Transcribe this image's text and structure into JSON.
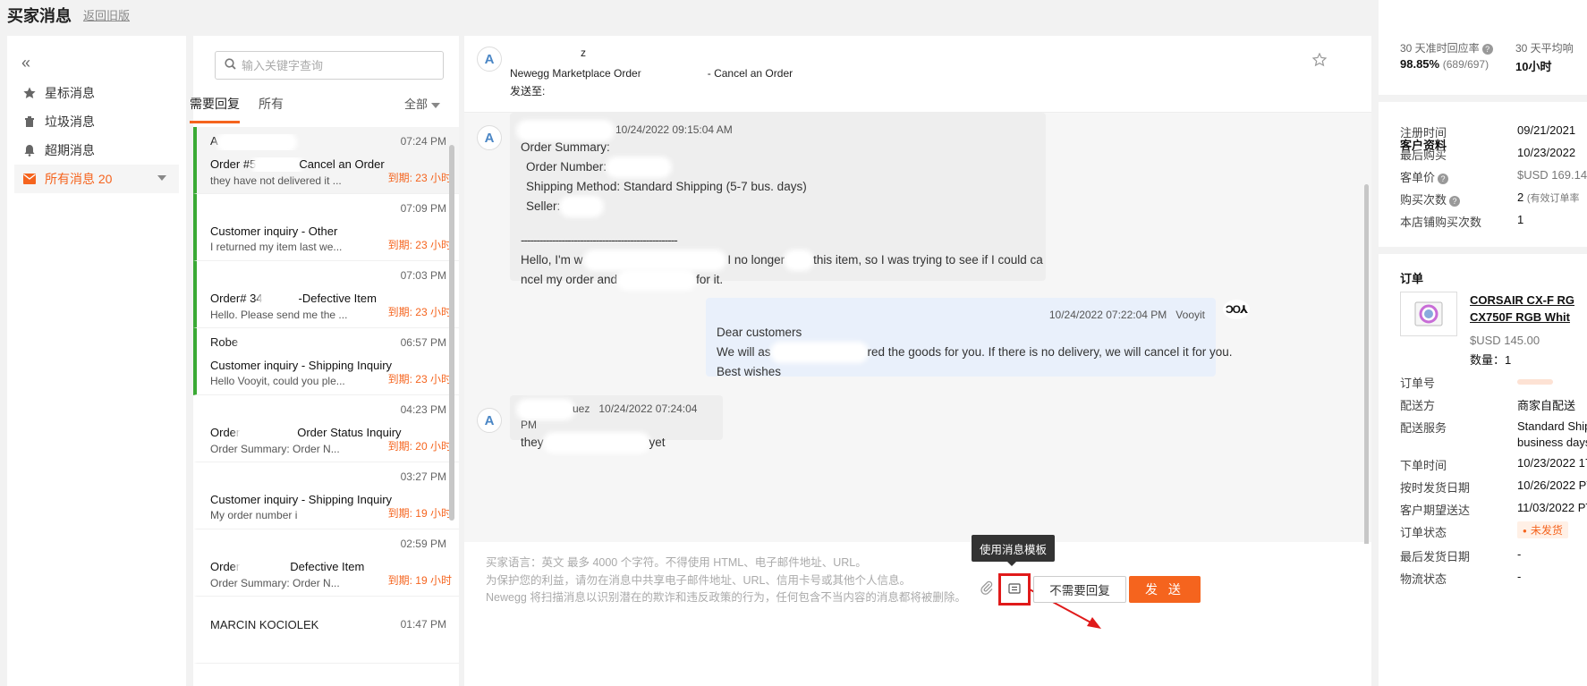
{
  "header": {
    "title": "买家消息",
    "back_link": "返回旧版"
  },
  "nav": {
    "collapse": "«",
    "items": [
      {
        "icon": "star-icon",
        "label": "星标消息"
      },
      {
        "icon": "trash-icon",
        "label": "垃圾消息"
      },
      {
        "icon": "bell-icon",
        "label": "超期消息"
      },
      {
        "icon": "mail-icon",
        "label": "所有消息 20"
      }
    ]
  },
  "list": {
    "search_placeholder": "输入关键字查询",
    "tabs": [
      "需要回复",
      "所有"
    ],
    "filter": "全部",
    "messages": [
      {
        "sender": "A",
        "time": "07:24 PM",
        "subject": "Order #5",
        "subject_suffix": "Cancel an Order",
        "preview": "they have not delivered it ...",
        "due": "到期: 23 小时"
      },
      {
        "sender": "",
        "time": "07:09 PM",
        "subject": "Customer inquiry - Other",
        "subject_suffix": "",
        "preview": "I returned my item last we...",
        "due": "到期: 23 小时"
      },
      {
        "sender": "",
        "time": "07:03 PM",
        "subject": "Order# 34",
        "subject_suffix": "-Defective Item",
        "preview": "Hello. Please send me the ...",
        "due": "到期: 23 小时"
      },
      {
        "sender": "Robe",
        "time": "06:57 PM",
        "subject": "Customer inquiry - Shipping Inquiry",
        "subject_suffix": "",
        "preview": "Hello Vooyit, could you ple...",
        "due": "到期: 23 小时"
      },
      {
        "sender": "",
        "time": "04:23 PM",
        "subject": "Order",
        "subject_suffix": "Order Status Inquiry",
        "preview": "Order Summary:   Order N...",
        "due": "到期: 20 小时"
      },
      {
        "sender": "",
        "time": "03:27 PM",
        "subject": "Customer inquiry - Shipping Inquiry",
        "subject_suffix": "",
        "preview": "My order number i",
        "due": "到期: 19 小时"
      },
      {
        "sender": "",
        "time": "02:59 PM",
        "subject": "Order",
        "subject_suffix": "Defective Item",
        "preview": "Order Summary:   Order N...",
        "due": "到期: 19 小时"
      },
      {
        "sender": "MARCIN KOCIOLEK",
        "time": "01:47 PM",
        "subject": "",
        "subject_suffix": "",
        "preview": "",
        "due": ""
      }
    ]
  },
  "conversation": {
    "header": {
      "avatar": "A",
      "name": "z",
      "subject": "Newegg Marketplace Order",
      "subject_suffix": "- Cancel an Order",
      "to": "发送至:"
    },
    "messages": [
      {
        "dir": "in",
        "avatar": "A",
        "timestamp": "10/24/2022 09:15:04 AM",
        "lines": [
          "Order Summary:",
          "  Order Number:",
          "  Shipping Method: Standard Shipping (5-7 bus. days)",
          "  Seller:",
          "",
          "--------------------------------------------------",
          "Hello, I'm w",
          "I no longer",
          "this item, so I was trying to see if I could ca",
          "ncel my order and",
          "for it."
        ]
      },
      {
        "dir": "out",
        "sender": "Vooyit",
        "timestamp": "10/24/2022 07:22:04 PM",
        "lines": [
          "Dear customers",
          "We will as",
          "red the goods for you. If there is no delivery, we will cancel it for you.",
          "Best wishes"
        ]
      },
      {
        "dir": "in",
        "avatar": "A",
        "name": "uez",
        "timestamp": "10/24/2022 07:24:04 PM",
        "lines": [
          "they",
          "yet"
        ]
      }
    ],
    "compose_hints": [
      "买家语言：英文 最多 4000 个字符。不得使用 HTML、电子邮件地址、URL。",
      "为保护您的利益，请勿在消息中共享电子邮件地址、URL、信用卡号或其他个人信息。",
      "Newegg 将扫描消息以识别潜在的欺诈和违反政策的行为，任何包含不当内容的消息都将被删除。"
    ],
    "tooltip": "使用消息模板",
    "no_reply_label": "不需要回复",
    "send_label": "发 送"
  },
  "right": {
    "stats": [
      {
        "label": "30 天准时回应率",
        "value": "98.85%",
        "detail": "(689/697)"
      },
      {
        "label": "30 天平均响",
        "value": "10小时",
        "detail": ""
      }
    ],
    "customer": {
      "title": "客户资料",
      "rows": [
        {
          "k": "注册时间",
          "v": "09/21/2021"
        },
        {
          "k": "最后购买",
          "v": "10/23/2022"
        },
        {
          "k": "客单价",
          "v": "$USD 169.14"
        },
        {
          "k": "购买次数",
          "v": "2",
          "note": "(有效订单率"
        },
        {
          "k": "本店铺购买次数",
          "v": "1"
        }
      ]
    },
    "order": {
      "title": "订单",
      "product_name_1": "CORSAIR CX-F RG",
      "product_name_2": "CX750F RGB Whit",
      "price": "$USD 145.00",
      "qty": "数量：1",
      "rows": [
        {
          "k": "订单号",
          "v": ""
        },
        {
          "k": "配送方",
          "v": "商家自配送"
        },
        {
          "k": "配送服务",
          "v": "Standard Ship",
          "v2": "business days"
        },
        {
          "k": "下单时间",
          "v": "10/23/2022 17"
        },
        {
          "k": "按时发货日期",
          "v": "10/26/2022 PT"
        },
        {
          "k": "客户期望送达",
          "v": "11/03/2022 PT"
        },
        {
          "k": "订单状态",
          "v": "未发货"
        },
        {
          "k": "最后发货日期",
          "v": "-"
        },
        {
          "k": "物流状态",
          "v": "-"
        }
      ]
    }
  },
  "colors": {
    "accent": "#f5641e",
    "unread_bar": "#3aaa35",
    "highlight": "#e01a1a"
  }
}
